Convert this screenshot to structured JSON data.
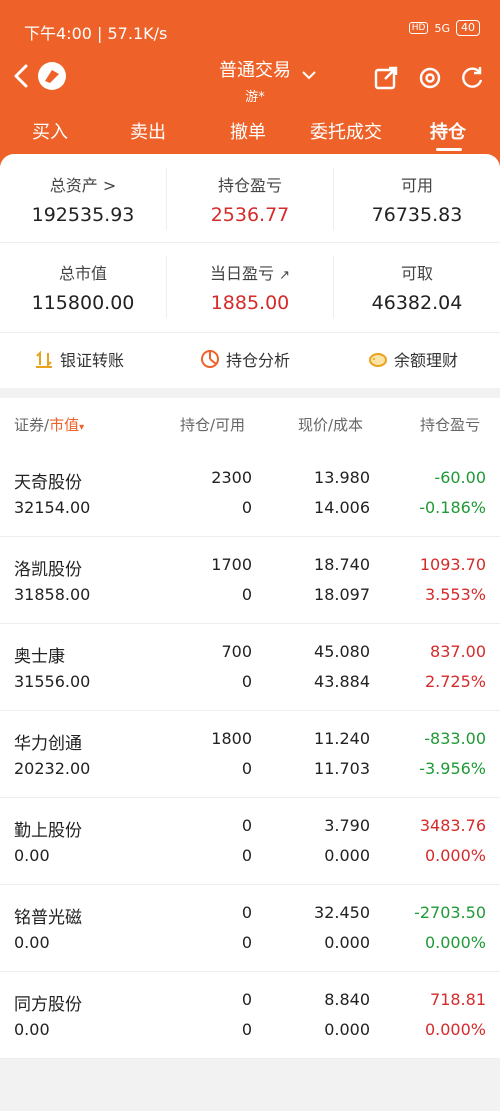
{
  "status_bar": {
    "time_speed": "下午4:00 | 57.1K/s",
    "battery": "40",
    "hd": "HD",
    "net": "5G"
  },
  "header": {
    "title": "普通交易",
    "subtitle": "游*"
  },
  "colors": {
    "brand": "#ee6229",
    "gain": "#d52b2b",
    "loss": "#1f9a36"
  },
  "tabs": [
    {
      "label": "买入"
    },
    {
      "label": "卖出"
    },
    {
      "label": "撤单"
    },
    {
      "label": "委托成交"
    },
    {
      "label": "持仓",
      "active": true
    }
  ],
  "summary": {
    "total_assets": {
      "label": "总资产 >",
      "value": "192535.93"
    },
    "position_pl": {
      "label": "持仓盈亏",
      "value": "2536.77"
    },
    "available": {
      "label": "可用",
      "value": "76735.83"
    },
    "market_value": {
      "label": "总市值",
      "value": "115800.00"
    },
    "daily_pl": {
      "label": "当日盈亏",
      "value": "1885.00"
    },
    "withdrawable": {
      "label": "可取",
      "value": "46382.04"
    }
  },
  "actions": {
    "bank_transfer": "银证转账",
    "position_analysis": "持仓分析",
    "wealth": "余额理财"
  },
  "table": {
    "headers": {
      "security": "证券/",
      "market_value": "市值",
      "hold_avail": "持仓/可用",
      "price_cost": "现价/成本",
      "pl": "持仓盈亏"
    },
    "rows": [
      {
        "name": "天奇股份",
        "market_value": "32154.00",
        "hold": "2300",
        "avail": "0",
        "price": "13.980",
        "cost": "14.006",
        "pl": "-60.00",
        "pl_pct": "-0.186%",
        "trend": "loss"
      },
      {
        "name": "洛凯股份",
        "market_value": "31858.00",
        "hold": "1700",
        "avail": "0",
        "price": "18.740",
        "cost": "18.097",
        "pl": "1093.70",
        "pl_pct": "3.553%",
        "trend": "gain"
      },
      {
        "name": "奥士康",
        "market_value": "31556.00",
        "hold": "700",
        "avail": "0",
        "price": "45.080",
        "cost": "43.884",
        "pl": "837.00",
        "pl_pct": "2.725%",
        "trend": "gain"
      },
      {
        "name": "华力创通",
        "market_value": "20232.00",
        "hold": "1800",
        "avail": "0",
        "price": "11.240",
        "cost": "11.703",
        "pl": "-833.00",
        "pl_pct": "-3.956%",
        "trend": "loss"
      },
      {
        "name": "勤上股份",
        "market_value": "0.00",
        "hold": "0",
        "avail": "0",
        "price": "3.790",
        "cost": "0.000",
        "pl": "3483.76",
        "pl_pct": "0.000%",
        "trend": "gain"
      },
      {
        "name": "铭普光磁",
        "market_value": "0.00",
        "hold": "0",
        "avail": "0",
        "price": "32.450",
        "cost": "0.000",
        "pl": "-2703.50",
        "pl_pct": "0.000%",
        "trend": "loss"
      },
      {
        "name": "同方股份",
        "market_value": "0.00",
        "hold": "0",
        "avail": "0",
        "price": "8.840",
        "cost": "0.000",
        "pl": "718.81",
        "pl_pct": "0.000%",
        "trend": "gain"
      }
    ]
  }
}
